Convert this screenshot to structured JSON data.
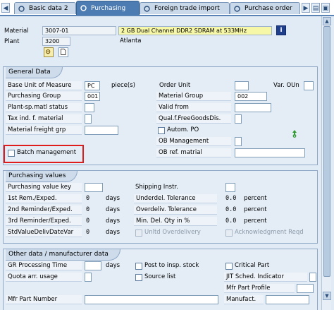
{
  "tabs": [
    {
      "label": "Basic data 2",
      "active": false
    },
    {
      "label": "Purchasing",
      "active": true
    },
    {
      "label": "Foreign trade import",
      "active": false
    },
    {
      "label": "Purchase order",
      "active": false
    }
  ],
  "header": {
    "material_label": "Material",
    "material_value": "3007-01",
    "material_desc": "2 GB Dual Channel DDR2 SDRAM at 533MHz",
    "plant_label": "Plant",
    "plant_value": "3200",
    "plant_name": "Atlanta",
    "info_icon": "info-icon",
    "accent": "#f7f7a8"
  },
  "general": {
    "title": "General Data",
    "base_uom_label": "Base Unit of Measure",
    "base_uom_value": "PC",
    "base_uom_text": "piece(s)",
    "order_unit_label": "Order Unit",
    "var_oun_label": "Var. OUn",
    "purch_group_label": "Purchasing Group",
    "purch_group_value": "001",
    "material_group_label": "Material Group",
    "material_group_value": "002",
    "plant_status_label": "Plant-sp.matl status",
    "valid_from_label": "Valid from",
    "tax_ind_label": "Tax ind. f. material",
    "qual_free_goods_label": "Qual.f.FreeGoodsDis.",
    "freight_grp_label": "Material freight grp",
    "autom_po_label": "Autom. PO",
    "ob_management_label": "OB Management",
    "batch_mgmt_label": "Batch management",
    "ob_ref_label": "OB ref. matrial"
  },
  "purchasing_values": {
    "title": "Purchasing values",
    "value_key_label": "Purchasing value key",
    "shipping_instr_label": "Shipping Instr.",
    "rem1_label": "1st Rem./Exped.",
    "rem1_value": "0",
    "rem1_unit": "days",
    "underdel_label": "Underdel. Tolerance",
    "underdel_value": "0.0",
    "underdel_unit": "percent",
    "rem2_label": "2nd Reminder/Exped.",
    "rem2_value": "0",
    "rem2_unit": "days",
    "overdel_label": "Overdeliv. Tolerance",
    "overdel_value": "0.0",
    "overdel_unit": "percent",
    "rem3_label": "3rd Reminder/Exped.",
    "rem3_value": "0",
    "rem3_unit": "days",
    "min_del_label": "Min. Del. Qty in %",
    "min_del_value": "0.0",
    "min_del_unit": "percent",
    "std_val_label": "StdValueDelivDateVar",
    "std_val_value": "0",
    "std_val_unit": "days",
    "unltd_label": "Unltd Overdelivery",
    "ack_label": "Acknowledgment Reqd"
  },
  "other": {
    "title": "Other data / manufacturer data",
    "gr_time_label": "GR Processing Time",
    "gr_time_unit": "days",
    "post_insp_label": "Post to insp. stock",
    "critical_part_label": "Critical Part",
    "quota_label": "Quota arr. usage",
    "source_list_label": "Source list",
    "jit_label": "JIT Sched. Indicator",
    "mfr_profile_label": "Mfr Part Profile",
    "mfr_part_label": "Mfr Part Number",
    "manufact_label": "Manufact."
  }
}
